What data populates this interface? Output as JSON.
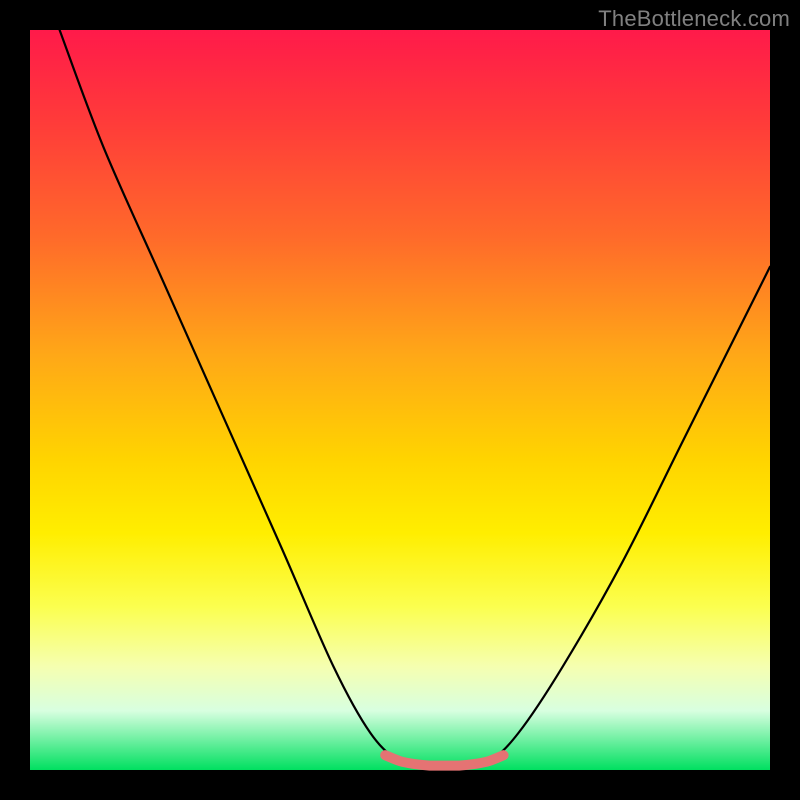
{
  "watermark": "TheBottleneck.com",
  "chart_data": {
    "type": "line",
    "title": "",
    "xlabel": "",
    "ylabel": "",
    "xlim": [
      0,
      100
    ],
    "ylim": [
      0,
      100
    ],
    "grid": false,
    "series": [
      {
        "name": "bottleneck-curve",
        "color": "#000000",
        "values": [
          {
            "x": 4,
            "y": 100
          },
          {
            "x": 10,
            "y": 84
          },
          {
            "x": 18,
            "y": 66
          },
          {
            "x": 26,
            "y": 48
          },
          {
            "x": 34,
            "y": 30
          },
          {
            "x": 41,
            "y": 14
          },
          {
            "x": 46,
            "y": 5
          },
          {
            "x": 50,
            "y": 1.2
          },
          {
            "x": 54,
            "y": 0.6
          },
          {
            "x": 58,
            "y": 0.6
          },
          {
            "x": 62,
            "y": 1.2
          },
          {
            "x": 66,
            "y": 5
          },
          {
            "x": 72,
            "y": 14
          },
          {
            "x": 80,
            "y": 28
          },
          {
            "x": 88,
            "y": 44
          },
          {
            "x": 96,
            "y": 60
          },
          {
            "x": 100,
            "y": 68
          }
        ]
      },
      {
        "name": "highlight-band",
        "color": "#e57373",
        "values": [
          {
            "x": 48,
            "y": 2.0
          },
          {
            "x": 50,
            "y": 1.2
          },
          {
            "x": 52,
            "y": 0.8
          },
          {
            "x": 54,
            "y": 0.6
          },
          {
            "x": 56,
            "y": 0.6
          },
          {
            "x": 58,
            "y": 0.6
          },
          {
            "x": 60,
            "y": 0.8
          },
          {
            "x": 62,
            "y": 1.2
          },
          {
            "x": 64,
            "y": 2.0
          }
        ]
      }
    ]
  }
}
